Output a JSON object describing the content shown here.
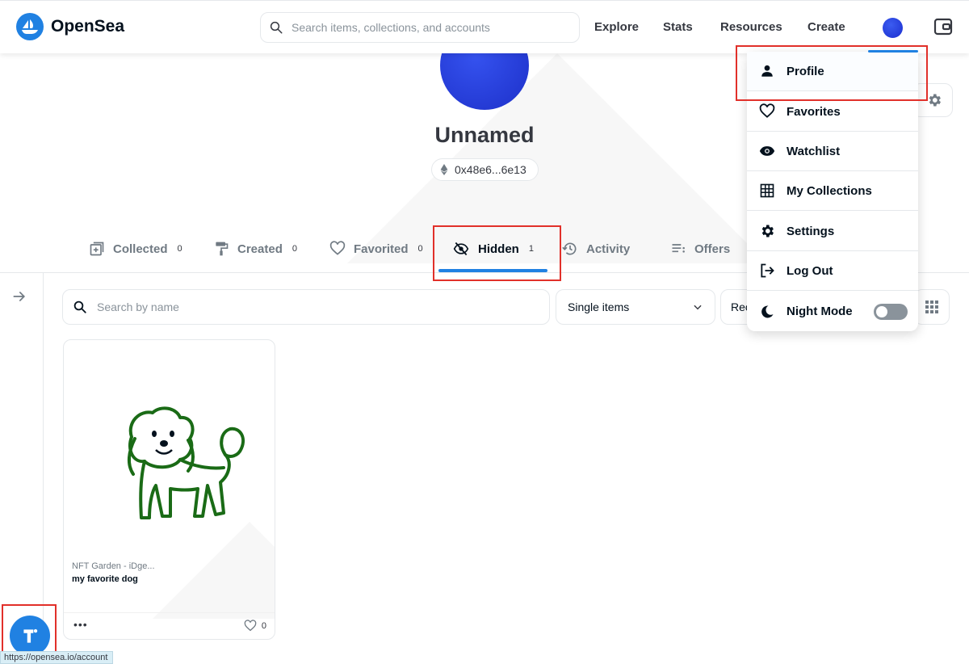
{
  "header": {
    "logo_text": "OpenSea",
    "search_placeholder": "Search items, collections, and accounts",
    "nav": [
      "Explore",
      "Stats",
      "Resources",
      "Create"
    ]
  },
  "profile": {
    "name": "Unnamed",
    "address": "0x48e6...6e13"
  },
  "tabs": [
    {
      "label": "Collected",
      "count": "0"
    },
    {
      "label": "Created",
      "count": "0"
    },
    {
      "label": "Favorited",
      "count": "0"
    },
    {
      "label": "Hidden",
      "count": "1"
    },
    {
      "label": "Activity",
      "count": ""
    },
    {
      "label": "Offers",
      "count": ""
    }
  ],
  "filters": {
    "search_placeholder": "Search by name",
    "items_select": "Single items",
    "sort_partial": "Rec"
  },
  "card": {
    "collection": "NFT Garden - iDge...",
    "name": "my favorite dog",
    "favorites": "0"
  },
  "menu": {
    "items": [
      "Profile",
      "Favorites",
      "Watchlist",
      "My Collections",
      "Settings",
      "Log Out",
      "Night Mode"
    ]
  },
  "status_bar": {
    "url": "https://opensea.io/account"
  },
  "colors": {
    "accent": "#2081e2",
    "annotation": "#e1302a"
  }
}
